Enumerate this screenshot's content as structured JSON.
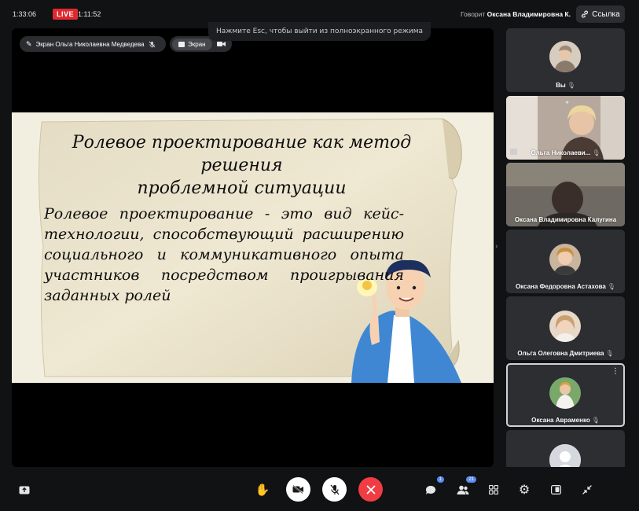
{
  "topbar": {
    "clock": "1:33:06",
    "live_label": "LIVE",
    "elapsed": "1:11:52",
    "speaking_prefix": "Говорит",
    "speaking_name": "Оксана Владимировна К.",
    "link_label": "Ссылка"
  },
  "esc_hint": "Нажмите Esc, чтобы выйти из полноэкранного режима",
  "stage": {
    "screen_owner_label": "Экран Ольга Николаевна Медведева",
    "screen_tab_label": "Экран"
  },
  "slide": {
    "title_line1": "Ролевое  проектирование как метод решения",
    "title_line2": "проблемной  ситуации",
    "body": "Ролевое проектирование - это вид кейс- технологии, способствующий расширению социального и коммуникативного опыта участников посредством проигрывания заданных ролей"
  },
  "participants": [
    {
      "name": "Вы",
      "muted": true
    },
    {
      "name": "Ольга Николаеви...",
      "muted": true,
      "pinned": true,
      "sharing": true
    },
    {
      "name": "Оксана Владимировна Калугина",
      "muted": false
    },
    {
      "name": "Оксана Федоровна Астахова",
      "muted": true
    },
    {
      "name": "Ольга Олеговна Дмитриева",
      "muted": true
    },
    {
      "name": "Оксана Авраменко",
      "muted": true,
      "more": true
    },
    {
      "name": "",
      "muted": false
    }
  ],
  "controls": {
    "chat_badge": "1",
    "participants_badge": "21"
  },
  "colors": {
    "live": "#e0292f",
    "end_call": "#f03d44",
    "slide_bg": "#f1ecd9",
    "badge": "#5a8cf0"
  }
}
